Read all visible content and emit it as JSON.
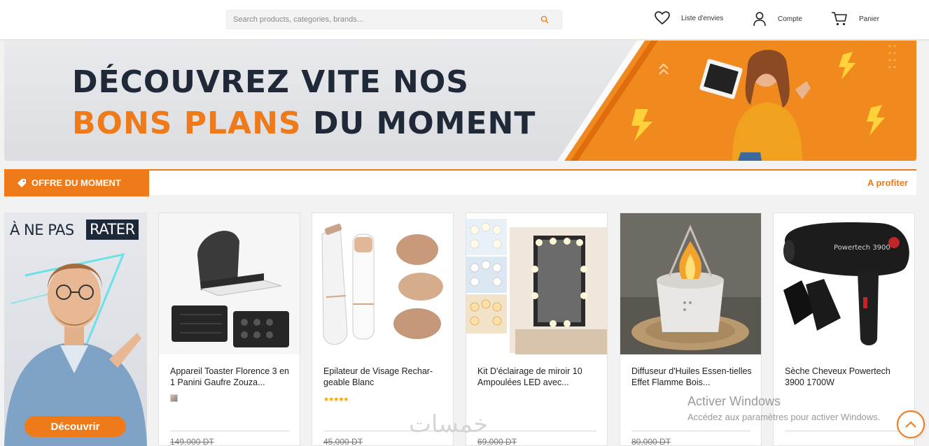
{
  "header": {
    "search_placeholder": "Search products, categories, brands...",
    "wishlist_label": "Liste d'envies",
    "account_label": "Compte",
    "cart_label": "Panier"
  },
  "hero": {
    "line1": "DÉCOUVREZ VITE NOS",
    "line2_highlight": "BONS PLANS",
    "line2_rest": " DU MOMENT",
    "accent_color": "#ef7a1a"
  },
  "section": {
    "title": "OFFRE DU MOMENT",
    "link": "A profiter"
  },
  "promo": {
    "text_prefix": "À NE PAS",
    "text_badge": "RATER",
    "button": "Découvrir"
  },
  "products": [
    {
      "name": "Appareil Toaster Florence 3 en 1 Panini Gaufre Zouza...",
      "old_price": "149,000 DT",
      "extra": "color-swatch"
    },
    {
      "name": "Epilateur de Visage Rechar-geable Blanc",
      "old_price": "45,000 DT",
      "rating_stars": 5
    },
    {
      "name": "Kit D'éclairage de miroir 10 Ampoulées LED avec...",
      "old_price": "69,000 DT"
    },
    {
      "name": "Diffuseur d'Huiles Essen-tielles Effet Flamme Bois...",
      "old_price": "80,000 DT"
    },
    {
      "name": "Sèche Cheveux Powertech 3900 1700W",
      "old_price": ""
    }
  ],
  "product_image_texts": {
    "dryer_model": "Powertech 3900"
  },
  "overlays": {
    "windows_title": "Activer Windows",
    "windows_sub": "Accédez aux paramètres pour activer Windows.",
    "watermark": "خمسات",
    "scroll_top_icon": "chevron-up-icon"
  }
}
